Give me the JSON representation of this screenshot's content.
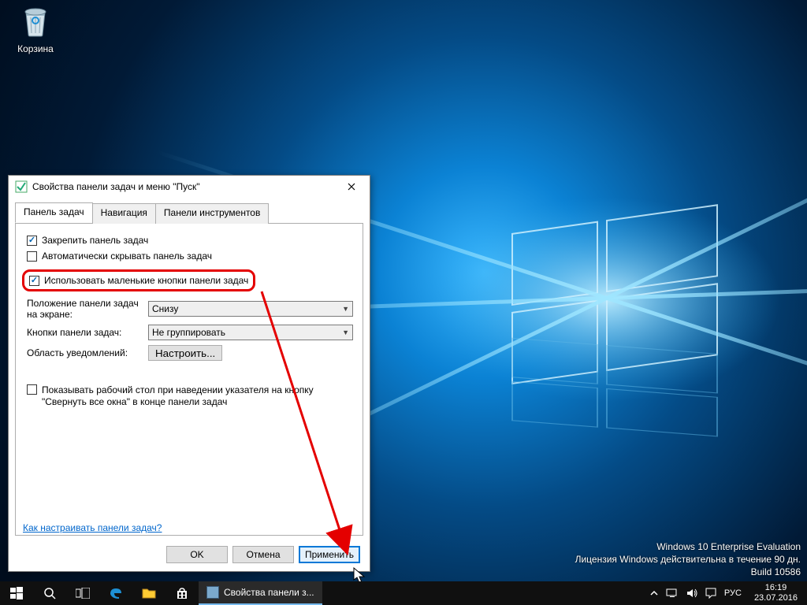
{
  "desktop": {
    "recycle_bin_label": "Корзина"
  },
  "watermark": {
    "line1": "Windows 10 Enterprise Evaluation",
    "line2": "Лицензия Windows действительна в течение 90 дн.",
    "line3": "Build 10586"
  },
  "taskbar": {
    "active_task": "Свойства панели з...",
    "lang": "РУС",
    "time": "16:19",
    "date": "23.07.2016"
  },
  "dialog": {
    "title": "Свойства панели задач и меню \"Пуск\"",
    "tabs": [
      "Панель задач",
      "Навигация",
      "Панели инструментов"
    ],
    "chk_lock": "Закрепить панель задач",
    "chk_autohide": "Автоматически скрывать панель задач",
    "chk_small": "Использовать маленькие кнопки панели задач",
    "lbl_position": "Положение панели задач на экране:",
    "val_position": "Снизу",
    "lbl_buttons": "Кнопки панели задач:",
    "val_buttons": "Не группировать",
    "lbl_notif": "Область уведомлений:",
    "btn_notif": "Настроить...",
    "chk_peek": "Показывать рабочий стол при наведении указателя на кнопку \"Свернуть все окна\" в конце панели задач",
    "help_link": "Как настраивать панели задач?",
    "btn_ok": "OK",
    "btn_cancel": "Отмена",
    "btn_apply": "Применить"
  }
}
